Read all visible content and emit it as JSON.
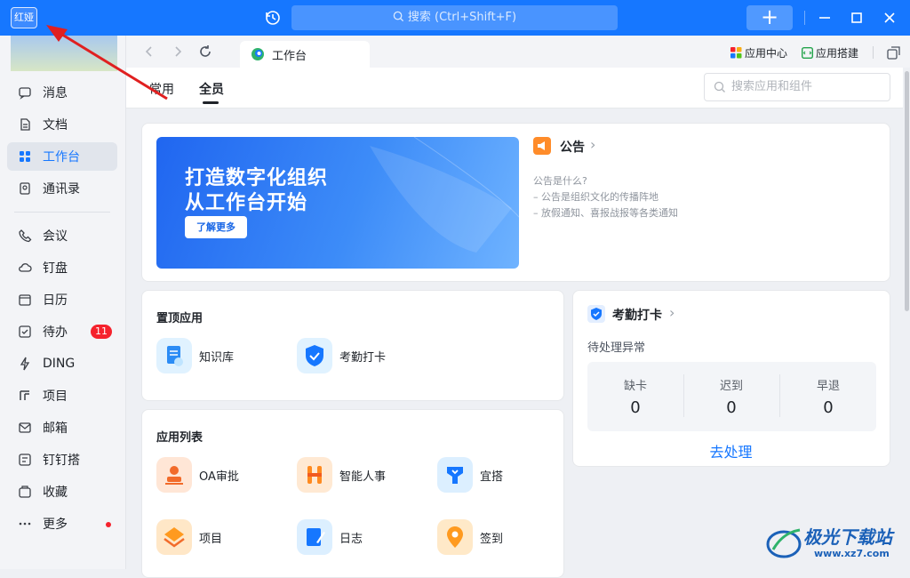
{
  "titlebar": {
    "avatar_text": "红娅",
    "search_placeholder": "搜索 (Ctrl+Shift+F)",
    "add_label": "+"
  },
  "sidebar": {
    "items": [
      {
        "label": "消息",
        "icon": "message-icon"
      },
      {
        "label": "文档",
        "icon": "document-icon"
      },
      {
        "label": "工作台",
        "icon": "grid-icon",
        "active": true
      },
      {
        "label": "通讯录",
        "icon": "contacts-icon"
      },
      {
        "label": "会议",
        "icon": "phone-icon"
      },
      {
        "label": "钉盘",
        "icon": "cloud-icon"
      },
      {
        "label": "日历",
        "icon": "calendar-icon"
      },
      {
        "label": "待办",
        "icon": "todo-icon",
        "badge": "11"
      },
      {
        "label": "DING",
        "icon": "lightning-icon"
      },
      {
        "label": "项目",
        "icon": "project-icon"
      },
      {
        "label": "邮箱",
        "icon": "mail-icon"
      },
      {
        "label": "钉钉搭",
        "icon": "builder-icon"
      },
      {
        "label": "收藏",
        "icon": "favorite-icon"
      },
      {
        "label": "更多",
        "icon": "more-icon",
        "dot": true
      }
    ]
  },
  "tabs": {
    "workbench_label": "工作台",
    "app_center": "应用中心",
    "app_builder": "应用搭建"
  },
  "subheader": {
    "tab_common": "常用",
    "tab_all": "全员",
    "search_placeholder": "搜索应用和组件"
  },
  "banner": {
    "line1": "打造数字化组织",
    "line2": "从工作台开始",
    "button": "了解更多"
  },
  "announcement": {
    "title": "公告",
    "q": "公告是什么?",
    "l1": "– 公告是组织文化的传播阵地",
    "l2": "– 放假通知、喜报战报等各类通知"
  },
  "pinned": {
    "title": "置顶应用",
    "apps": [
      "知识库",
      "考勤打卡"
    ]
  },
  "applist": {
    "title": "应用列表",
    "apps": [
      "OA审批",
      "智能人事",
      "宜搭",
      "项目",
      "日志",
      "签到"
    ]
  },
  "attendance": {
    "title": "考勤打卡",
    "pending": "待处理异常",
    "stats": [
      {
        "label": "缺卡",
        "value": "0"
      },
      {
        "label": "迟到",
        "value": "0"
      },
      {
        "label": "早退",
        "value": "0"
      }
    ],
    "action": "去处理"
  },
  "watermark": {
    "name": "极光下载站",
    "url": "www.xz7.com"
  },
  "colors": {
    "accent": "#1677ff",
    "badge": "#f5222d",
    "annotation_arrow": "#e02020"
  }
}
